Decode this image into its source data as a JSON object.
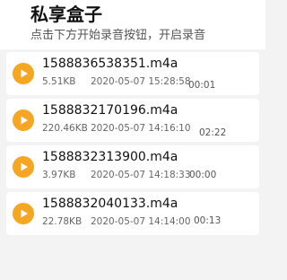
{
  "header": {
    "title": "私享盒子",
    "subtitle": "点击下方开始录音按钮，开启录音"
  },
  "accent_color": "#f5a623",
  "play_icon": "play-icon",
  "recordings": [
    {
      "name": "1588836538351.m4a",
      "size": "5.51KB",
      "date": "2020-05-07 15:28:58",
      "duration": "00:01"
    },
    {
      "name": "1588832170196.m4a",
      "size": "220.46KB",
      "date": "2020-05-07 14:16:10",
      "duration": "02:22"
    },
    {
      "name": "1588832313900.m4a",
      "size": "3.97KB",
      "date": "2020-05-07 14:18:33",
      "duration": "00:00"
    },
    {
      "name": "1588832040133.m4a",
      "size": "22.78KB",
      "date": "2020-05-07 14:14:00",
      "duration": "00:13"
    }
  ]
}
